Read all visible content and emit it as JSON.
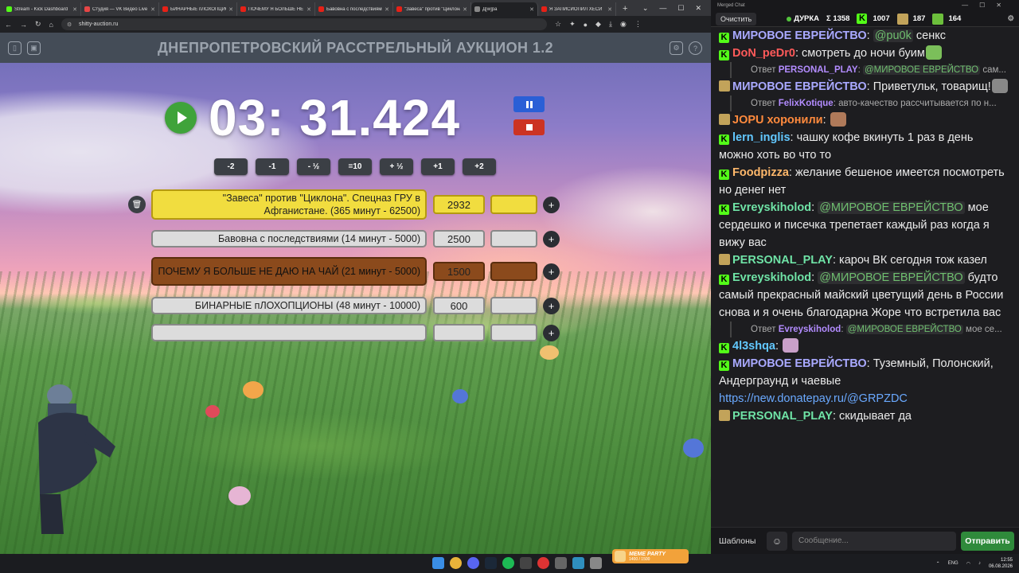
{
  "browser": {
    "tabs": [
      {
        "title": "Stream - Kick Dashboard",
        "color": "#53fc18"
      },
      {
        "title": "Студия — VK Видео Live",
        "color": "#e64646"
      },
      {
        "title": "БИНАРНЫЕ пЛОХОПЦИО",
        "color": "#e62117"
      },
      {
        "title": "ПОЧЕМУ Я БОЛЬШЕ НЕ",
        "color": "#e62117"
      },
      {
        "title": "Бавовна с последствиями",
        "color": "#e62117"
      },
      {
        "title": "\"Завеса\" против \"Циклона\"",
        "color": "#e62117"
      },
      {
        "title": "Д[w]ра",
        "color": "#888888",
        "active": true
      },
      {
        "title": "Я ЗАПИСИОПИЛ ХЕСИ",
        "color": "#e62117"
      }
    ],
    "url": "shitty-auction.ru"
  },
  "app": {
    "title": "ДНЕПРОПЕТРОВСКИЙ РАССТРЕЛЬНЫЙ АУКЦИОН 1.2",
    "timer": "03: 31.424",
    "adjust_buttons": [
      "-2",
      "-1",
      "- ½",
      "=10",
      "+ ½",
      "+1",
      "+2"
    ],
    "lots": [
      {
        "name": "\"Завеса\" против \"Циклона\". Спецназ ГРУ в Афганистане. (365 минут - 62500)",
        "amount": "2932",
        "add": "",
        "color": "#f1dd3f",
        "border": "#b59a10"
      },
      {
        "name": "Бавовна с последствиями (14 минут - 5000)",
        "amount": "2500",
        "add": "",
        "color": "#dcdcdc",
        "border": "#888888"
      },
      {
        "name": "ПОЧЕМУ Я БОЛЬШЕ НЕ ДАЮ НА ЧАЙ (21 минут - 5000)",
        "amount": "1500",
        "add": "",
        "color": "#8b4a1c",
        "border": "#5a2e0e"
      },
      {
        "name": "БИНАРНЫЕ пЛОХОПЦИОНЫ (48 минут - 10000)",
        "amount": "600",
        "add": "",
        "color": "#dcdcdc",
        "border": "#888888"
      },
      {
        "name": "",
        "amount": "",
        "add": "",
        "color": "#dcdcdc",
        "border": "#888888"
      }
    ]
  },
  "chat": {
    "window_title": "Merged Chat",
    "clear_label": "Очистить",
    "streamer": "ДУРКА",
    "stats": [
      {
        "icon": "sigma",
        "value": "Σ 1358"
      },
      {
        "icon": "kick-icon",
        "value": "1007"
      },
      {
        "icon": "vk-icon",
        "value": "187"
      },
      {
        "icon": "pepe-icon",
        "value": "164"
      }
    ],
    "messages": [
      {
        "type": "msg",
        "badge": "kick",
        "user": "МИРОВОЕ ЕВРЕЙСТВО",
        "ucolor": "#a9a9ff",
        "mention": "@pu0k",
        "text": "сенкс"
      },
      {
        "type": "msg",
        "badge": "kick",
        "user": "DoN_peDr0",
        "ucolor": "#ff5a5a",
        "mention": "",
        "text": "смотреть до ночи буим"
      },
      {
        "type": "reply",
        "label": "Ответ",
        "user": "PERSONAL_PLAY",
        "ucolor": "#b38cff",
        "mention": "@МИРОВОЕ ЕВРЕЙСТВО",
        "text": "сам..."
      },
      {
        "type": "msg",
        "badge": "vk",
        "user": "МИРОВОЕ ЕВРЕЙСТВО",
        "ucolor": "#a9a9ff",
        "mention": "",
        "text": "Приветульк, товарищ!"
      },
      {
        "type": "reply",
        "label": "Ответ",
        "user": "FelixKotique",
        "ucolor": "#b38cff",
        "mention": "",
        "text": "авто-качество рассчитывается по н..."
      },
      {
        "type": "msg",
        "badge": "vk",
        "user": "JOPU хоронили",
        "ucolor": "#ff8a3d",
        "mention": "",
        "text": ""
      },
      {
        "type": "msg",
        "badge": "kick",
        "user": "lern_inglis",
        "ucolor": "#62c8ff",
        "mention": "",
        "text": "чашку кофе вкинуть 1 раз в день можно хоть во что то"
      },
      {
        "type": "msg",
        "badge": "kick",
        "user": "Foodpizza",
        "ucolor": "#ffb86b",
        "mention": "",
        "text": "желание бешеное имеется посмотреть но денег нет"
      },
      {
        "type": "msg",
        "badge": "kick",
        "user": "Evreyskiholod",
        "ucolor": "#6fe3a6",
        "mention": "@МИРОВОЕ ЕВРЕЙСТВО",
        "text": "мое сердешко и писечка трепетает каждый раз когда я вижу вас"
      },
      {
        "type": "msg",
        "badge": "vk",
        "user": "PERSONAL_PLAY",
        "ucolor": "#6fe3a6",
        "mention": "",
        "text": "кароч ВК сегодня тож казел"
      },
      {
        "type": "msg",
        "badge": "kick",
        "user": "Evreyskiholod",
        "ucolor": "#6fe3a6",
        "mention": "@МИРОВОЕ ЕВРЕЙСТВО",
        "text": "будто самый прекрасный майский цветущий день в России снова  и я очень благодарна Жоре что встретила вас"
      },
      {
        "type": "reply",
        "label": "Ответ",
        "user": "Evreyskiholod",
        "ucolor": "#b38cff",
        "mention": "@МИРОВОЕ ЕВРЕЙСТВО",
        "text": "мое се..."
      },
      {
        "type": "msg",
        "badge": "kick",
        "user": "4l3shqa",
        "ucolor": "#62c8ff",
        "mention": "",
        "text": ""
      },
      {
        "type": "msg",
        "badge": "kick",
        "user": "МИРОВОЕ ЕВРЕЙСТВО",
        "ucolor": "#a9a9ff",
        "mention": "",
        "text": "Туземный, Полонский, Андерграунд и чаевые"
      },
      {
        "type": "link",
        "text": "https://new.donatepay.ru/@GRPZDC"
      },
      {
        "type": "msg",
        "badge": "vk",
        "user": "PERSONAL_PLAY",
        "ucolor": "#6fe3a6",
        "mention": "",
        "text": "скидывает да"
      }
    ],
    "templates_label": "Шаблоны",
    "input_placeholder": "Сообщение...",
    "send_label": "Отправить"
  },
  "taskbar": {
    "badge_title": "MEME PARTY",
    "badge_sub": "1400 / 1500",
    "lang": "ENG",
    "time": "12:55",
    "date": "06.08.2026"
  }
}
